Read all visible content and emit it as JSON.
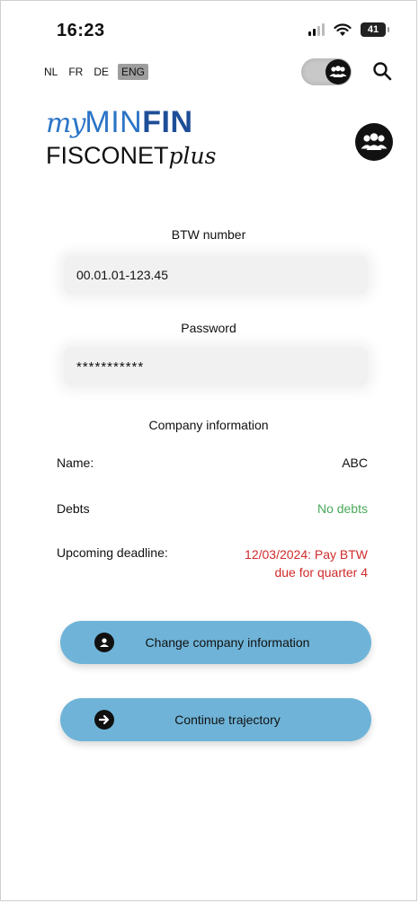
{
  "status_bar": {
    "time": "16:23",
    "battery": "41"
  },
  "languages": [
    {
      "code": "NL",
      "active": false
    },
    {
      "code": "FR",
      "active": false
    },
    {
      "code": "DE",
      "active": false
    },
    {
      "code": "ENG",
      "active": true
    }
  ],
  "icons": {
    "toggle": "people-group-icon",
    "search": "search-icon",
    "profile": "people-group-icon",
    "change": "user-circle-icon",
    "continue": "arrow-right-circle-icon"
  },
  "logo": {
    "my": "my",
    "min": "MIN",
    "fin": "FIN",
    "fisconet": "FISCONET",
    "plus": "plus"
  },
  "form": {
    "btw_label": "BTW number",
    "btw_value": "00.01.01-123.45",
    "password_label": "Password",
    "password_value": "***********"
  },
  "company": {
    "heading": "Company information",
    "name_label": "Name:",
    "name_value": "ABC",
    "debts_label": "Debts",
    "debts_value": "No debts",
    "deadline_label": "Upcoming deadline:",
    "deadline_line1": "12/03/2024: Pay BTW",
    "deadline_line2": "due for quarter 4"
  },
  "buttons": {
    "change": "Change company information",
    "continue": "Continue trajectory"
  },
  "colors": {
    "brand_blue": "#2b74c6",
    "button_blue": "#6fb4d8",
    "green": "#4aa85a",
    "red": "#d12b2b"
  }
}
